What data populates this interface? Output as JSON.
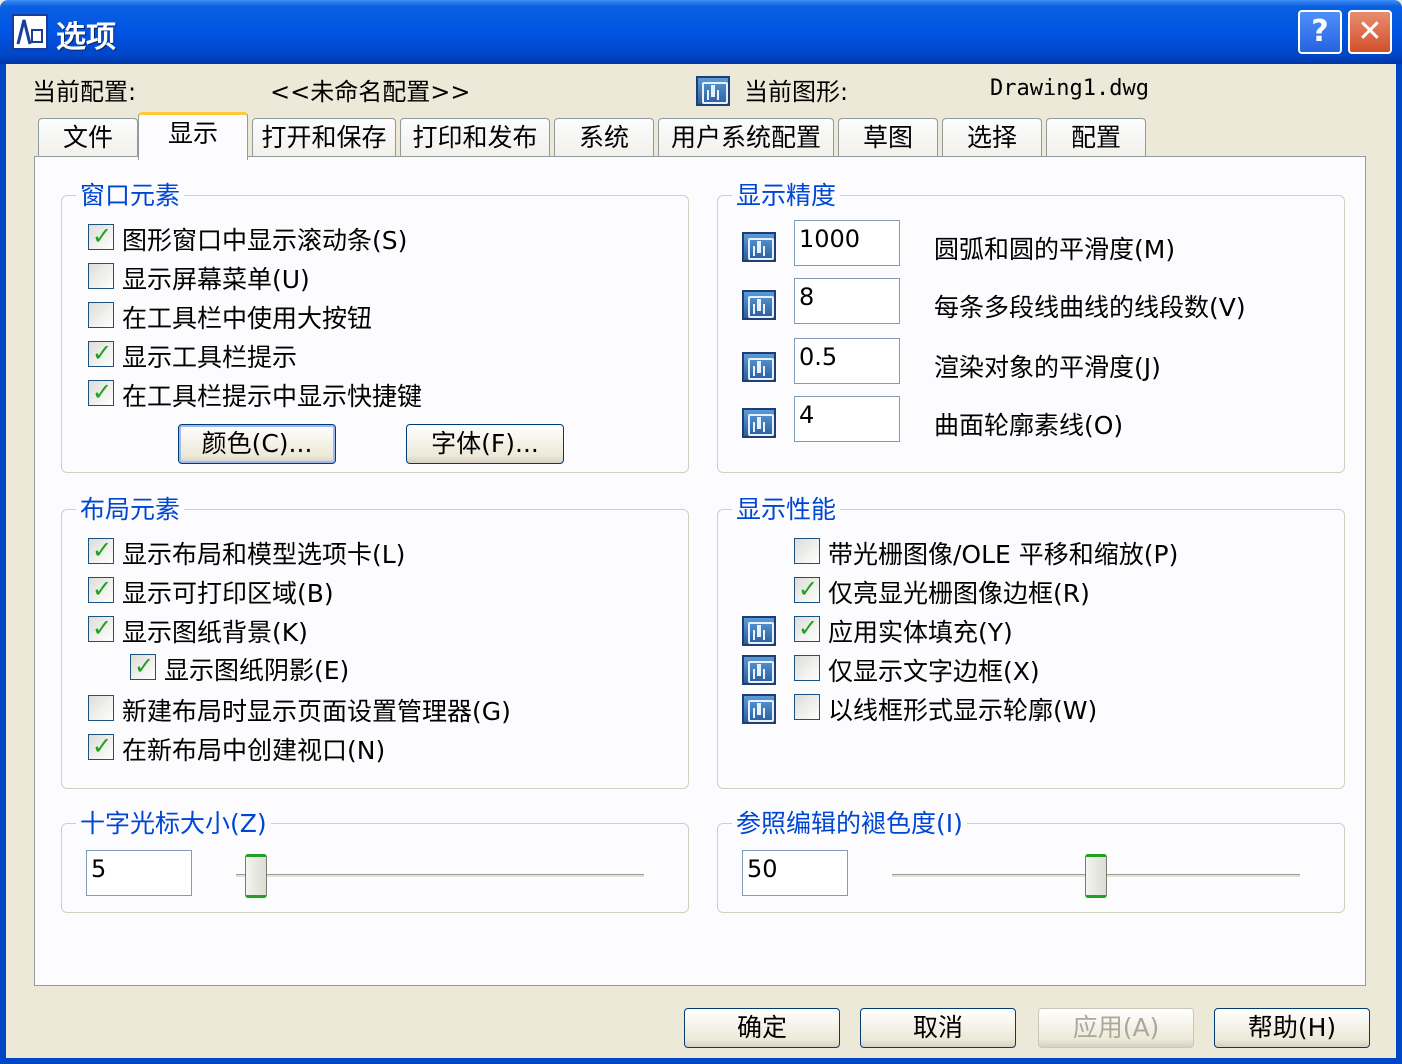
{
  "window": {
    "title": "选项",
    "help_glyph": "?",
    "close_glyph": "✕"
  },
  "header": {
    "profile_label": "当前配置:",
    "profile_value": "<<未命名配置>>",
    "drawing_label": "当前图形:",
    "drawing_value": "Drawing1.dwg"
  },
  "tabs": [
    "文件",
    "显示",
    "打开和保存",
    "打印和发布",
    "系统",
    "用户系统配置",
    "草图",
    "选择",
    "配置"
  ],
  "active_tab": "显示",
  "window_elements": {
    "title": "窗口元素",
    "items": [
      {
        "label": "图形窗口中显示滚动条(S)",
        "checked": true
      },
      {
        "label": "显示屏幕菜单(U)",
        "checked": false
      },
      {
        "label": "在工具栏中使用大按钮",
        "checked": false
      },
      {
        "label": "显示工具栏提示",
        "checked": true
      },
      {
        "label": "在工具栏提示中显示快捷键",
        "checked": true
      }
    ],
    "colors_button": "颜色(C)...",
    "fonts_button": "字体(F)..."
  },
  "display_resolution": {
    "title": "显示精度",
    "items": [
      {
        "value": "1000",
        "label": "圆弧和圆的平滑度(M)"
      },
      {
        "value": "8",
        "label": "每条多段线曲线的线段数(V)"
      },
      {
        "value": "0.5",
        "label": "渲染对象的平滑度(J)"
      },
      {
        "value": "4",
        "label": "曲面轮廓素线(O)"
      }
    ]
  },
  "layout_elements": {
    "title": "布局元素",
    "items": [
      {
        "label": "显示布局和模型选项卡(L)",
        "checked": true
      },
      {
        "label": "显示可打印区域(B)",
        "checked": true
      },
      {
        "label": "显示图纸背景(K)",
        "checked": true
      },
      {
        "label": "显示图纸阴影(E)",
        "checked": true
      },
      {
        "label": "新建布局时显示页面设置管理器(G)",
        "checked": false
      },
      {
        "label": "在新布局中创建视口(N)",
        "checked": true
      }
    ]
  },
  "display_performance": {
    "title": "显示性能",
    "items": [
      {
        "label": "带光栅图像/OLE 平移和缩放(P)",
        "checked": false
      },
      {
        "label": "仅亮显光栅图像边框(R)",
        "checked": true
      },
      {
        "label": "应用实体填充(Y)",
        "checked": true
      },
      {
        "label": "仅显示文字边框(X)",
        "checked": false
      },
      {
        "label": "以线框形式显示轮廓(W)",
        "checked": false
      }
    ]
  },
  "crosshair": {
    "title": "十字光标大小(Z)",
    "value": "5",
    "slider_fraction": 0.05
  },
  "xref_fade": {
    "title": "参照编辑的褪色度(I)",
    "value": "50",
    "slider_fraction": 0.5
  },
  "footer": {
    "ok": "确定",
    "cancel": "取消",
    "apply": "应用(A)",
    "help": "帮助(H)"
  },
  "icons": {
    "dwg": "drawing-setting-icon",
    "check_color": "#21a121"
  }
}
